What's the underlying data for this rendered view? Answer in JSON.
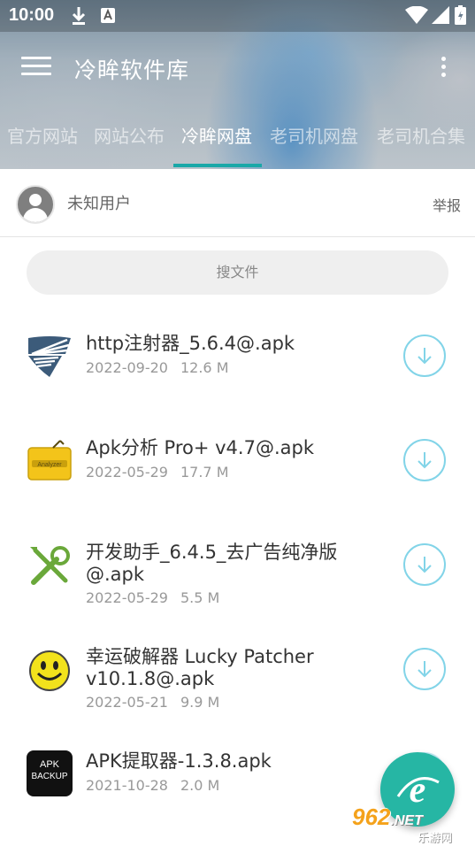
{
  "status_bar": {
    "time": "10:00"
  },
  "toolbar": {
    "title": "冷眸软件库"
  },
  "tabs": [
    {
      "label": "官方网站"
    },
    {
      "label": "网站公布"
    },
    {
      "label": "冷眸网盘",
      "active": true
    },
    {
      "label": "老司机网盘"
    },
    {
      "label": "老司机合集"
    }
  ],
  "user": {
    "name": "未知用户",
    "report_label": "举报"
  },
  "search": {
    "placeholder": "搜文件"
  },
  "files": [
    {
      "name": "http注射器_5.6.4@.apk",
      "date": "2022-09-20",
      "size": "12.6 M",
      "icon": "http-injector-icon"
    },
    {
      "name": "Apk分析 Pro+ v4.7@.apk",
      "date": "2022-05-29",
      "size": "17.7 M",
      "icon": "apk-analyzer-icon"
    },
    {
      "name": "开发助手_6.4.5_去广告纯净版@.apk",
      "date": "2022-05-29",
      "size": "5.5 M",
      "icon": "dev-tools-icon"
    },
    {
      "name": "幸运破解器 Lucky Patcher v10.1.8@.apk",
      "date": "2022-05-21",
      "size": "9.9 M",
      "icon": "smiley-icon"
    },
    {
      "name": "APK提取器-1.3.8.apk",
      "date": "2021-10-28",
      "size": "2.0 M",
      "icon": "apk-backup-icon",
      "icon_text": [
        "APK",
        "BACKUP"
      ]
    }
  ],
  "watermark": {
    "logo": "962",
    "suffix": ".NET",
    "sub": "乐游网"
  },
  "colors": {
    "accent": "#26b6a4",
    "tab_indicator": "#1aa8a8",
    "download_ring": "#82d4e8"
  }
}
